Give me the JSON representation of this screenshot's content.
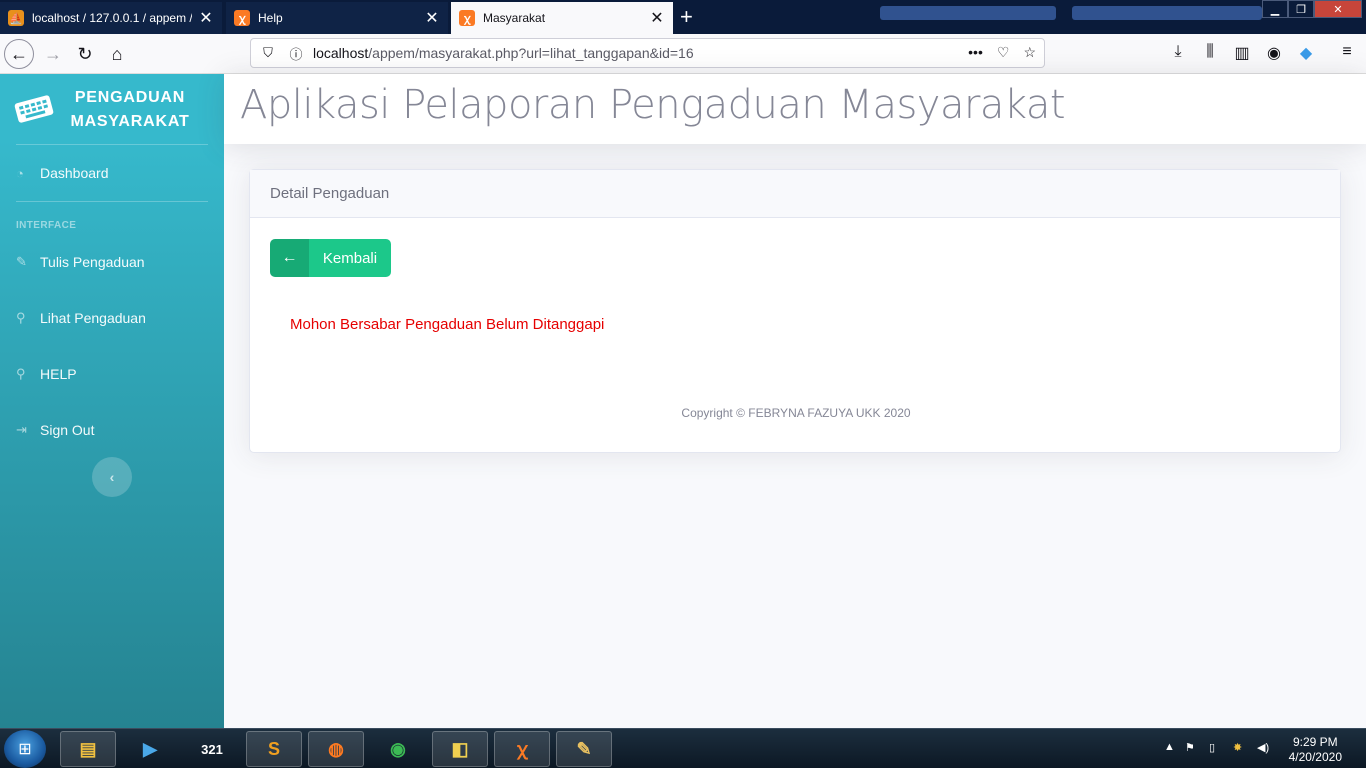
{
  "browser": {
    "tabs": [
      {
        "label": "localhost / 127.0.0.1 / appem / ...",
        "icon": "phpmyadmin-icon",
        "active": false
      },
      {
        "label": "Help",
        "icon": "xampp-icon",
        "active": false
      },
      {
        "label": "Masyarakat",
        "icon": "xampp-icon",
        "active": true
      }
    ],
    "close_glyph": "✕",
    "new_tab_glyph": "+",
    "url": {
      "host": "localhost",
      "path": "/appem/masyarakat.php?url=lihat_tanggapan&id=16"
    }
  },
  "sidebar": {
    "brand": "PENGADUAN MASYARAKAT",
    "dashboard": "Dashboard",
    "heading": "INTERFACE",
    "items": [
      {
        "label": "Tulis Pengaduan",
        "icon": "edit-icon"
      },
      {
        "label": "Lihat Pengaduan",
        "icon": "search-icon"
      },
      {
        "label": "HELP",
        "icon": "search-icon"
      },
      {
        "label": "Sign Out",
        "icon": "sign-out-icon"
      }
    ],
    "toggle_glyph": "‹"
  },
  "topbar": {
    "title": "Aplikasi Pelaporan Pengaduan Masyarakat"
  },
  "card": {
    "header": "Detail Pengaduan",
    "back_button": "Kembali",
    "message": "Mohon Bersabar Pengaduan Belum Ditanggapi",
    "copyright": "Copyright © FEBRYNA FAZUYA UKK 2020"
  },
  "taskbar": {
    "time": "9:29 PM",
    "date": "4/20/2020"
  },
  "colors": {
    "sidebar_top": "#36b9cc",
    "sidebar_bottom": "#258391",
    "success": "#1cc88a",
    "message": "#e60000"
  }
}
